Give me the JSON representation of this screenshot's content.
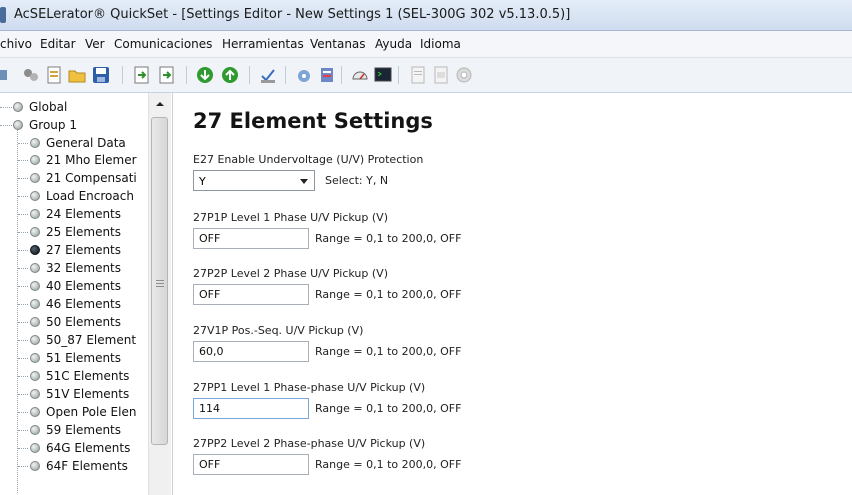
{
  "window": {
    "title": "AcSELerator® QuickSet - [Settings Editor - New Settings 1 (SEL-300G 302 v5.13.0.5)]"
  },
  "menu": [
    "chivo",
    "Editar",
    "Ver",
    "Comunicaciones",
    "Herramientas",
    "Ventanas",
    "Ayuda",
    "Idioma"
  ],
  "toolbar_icons": [
    "open-icon",
    "connect-icon",
    "new-icon",
    "folder-icon",
    "save-icon",
    "export-icon",
    "import-icon",
    "read-icon",
    "send-icon",
    "spell-check-icon",
    "settings-wizard-icon",
    "driver-icon",
    "meter-icon",
    "terminal-icon",
    "report-icon",
    "event-icon",
    "gear-icon"
  ],
  "tree": {
    "items": [
      {
        "label": "Global",
        "level": 0
      },
      {
        "label": "Group 1",
        "level": 0
      },
      {
        "label": "General Data",
        "level": 1
      },
      {
        "label": "21 Mho Elemer",
        "level": 1
      },
      {
        "label": "21 Compensati",
        "level": 1
      },
      {
        "label": "Load Encroach",
        "level": 1
      },
      {
        "label": "24 Elements",
        "level": 1
      },
      {
        "label": "25 Elements",
        "level": 1
      },
      {
        "label": "27 Elements",
        "level": 1,
        "selected": true
      },
      {
        "label": "32 Elements",
        "level": 1
      },
      {
        "label": "40 Elements",
        "level": 1
      },
      {
        "label": "46 Elements",
        "level": 1
      },
      {
        "label": "50 Elements",
        "level": 1
      },
      {
        "label": "50_87 Element",
        "level": 1
      },
      {
        "label": "51 Elements",
        "level": 1
      },
      {
        "label": "51C Elements",
        "level": 1
      },
      {
        "label": "51V Elements",
        "level": 1
      },
      {
        "label": "Open Pole Elen",
        "level": 1
      },
      {
        "label": "59 Elements",
        "level": 1
      },
      {
        "label": "64G Elements",
        "level": 1
      },
      {
        "label": "64F Elements",
        "level": 1
      }
    ]
  },
  "editor": {
    "title": "27 Element Settings",
    "e27": {
      "label": "E27  Enable Undervoltage (U/V) Protection",
      "value": "Y",
      "hint": "Select: Y, N"
    },
    "p1p": {
      "label": "27P1P  Level 1 Phase U/V Pickup (V)",
      "value": "OFF",
      "range": "Range = 0,1 to 200,0, OFF"
    },
    "p2p": {
      "label": "27P2P  Level 2 Phase U/V Pickup (V)",
      "value": "OFF",
      "range": "Range = 0,1 to 200,0, OFF"
    },
    "v1p": {
      "label": "27V1P  Pos.-Seq. U/V Pickup (V)",
      "value": "60,0",
      "range": "Range = 0,1 to 200,0, OFF"
    },
    "pp1": {
      "label": "27PP1  Level 1 Phase-phase U/V Pickup (V)",
      "value": "114",
      "range": "Range = 0,1 to 200,0, OFF"
    },
    "pp2": {
      "label": "27PP2  Level 2 Phase-phase U/V Pickup (V)",
      "value": "OFF",
      "range": "Range = 0,1 to 200,0, OFF"
    }
  }
}
